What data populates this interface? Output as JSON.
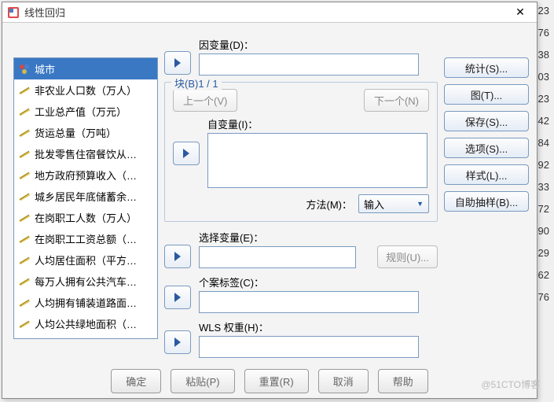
{
  "window": {
    "title": "线性回归",
    "close": "✕"
  },
  "variables": [
    {
      "label": "城市",
      "type": "nominal",
      "selected": true
    },
    {
      "label": "非农业人口数（万人）",
      "type": "scale"
    },
    {
      "label": "工业总产值（万元）",
      "type": "scale"
    },
    {
      "label": "货运总量（万吨）",
      "type": "scale"
    },
    {
      "label": "批发零售住宿餐饮从…",
      "type": "scale"
    },
    {
      "label": "地方政府预算收入（…",
      "type": "scale"
    },
    {
      "label": "城乡居民年底储蓄余…",
      "type": "scale"
    },
    {
      "label": "在岗职工人数（万人）",
      "type": "scale"
    },
    {
      "label": "在岗职工工资总额（…",
      "type": "scale"
    },
    {
      "label": "人均居住面积（平方…",
      "type": "scale"
    },
    {
      "label": "每万人拥有公共汽车…",
      "type": "scale"
    },
    {
      "label": "人均拥有铺装道路面…",
      "type": "scale"
    },
    {
      "label": "人均公共绿地面积（…",
      "type": "scale"
    }
  ],
  "fields": {
    "dependent_label": "因变量(D)：",
    "block_label": "块(B)1 / 1",
    "prev_label": "上一个(V)",
    "next_label": "下一个(N)",
    "independent_label": "自变量(I)：",
    "method_label": "方法(M)：",
    "method_value": "输入",
    "selection_label": "选择变量(E)：",
    "rule_label": "规则(U)...",
    "case_label": "个案标签(C)：",
    "wls_label": "WLS 权重(H)："
  },
  "side_buttons": [
    "统计(S)...",
    "图(T)...",
    "保存(S)...",
    "选项(S)...",
    "样式(L)...",
    "自助抽样(B)..."
  ],
  "bottom_buttons": [
    "确定",
    "粘贴(P)",
    "重置(R)",
    "取消",
    "帮助"
  ],
  "bg_values": [
    "23",
    "76",
    "38",
    "03",
    "23",
    "42",
    "84",
    "92",
    "33",
    "72",
    "90",
    "29",
    "62",
    "76"
  ],
  "watermark": "@51CTO博客"
}
